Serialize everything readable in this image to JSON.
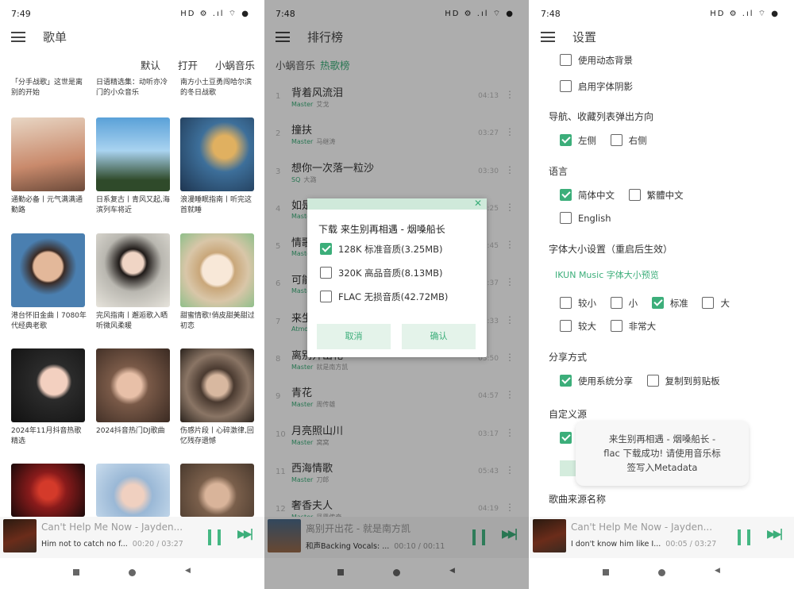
{
  "screens": {
    "playlists": {
      "status_time": "7:49",
      "status_icons": "HD ⚙ .ıl ⌔ ●",
      "title": "歌单",
      "sort_options": [
        "默认",
        "打开",
        "小蜗音乐"
      ],
      "top_captions": [
        "「分手战歌」这世是离别的开始",
        "日语精选集：动听亦冷门的小众音乐",
        "南方小土豆勇闯哈尔滨的冬日战歌"
      ],
      "playlists": [
        {
          "caption": "通勤必备丨元气满满通勤路",
          "color": "#c98a6c"
        },
        {
          "caption": "日系复古丨青风又起,海滨列车将近",
          "color": "#5aa1d8"
        },
        {
          "caption": "浪漫睡眠指南丨听完这首就睡",
          "color": "#3d6f9a"
        },
        {
          "caption": "港台怀旧金曲丨7080年代经典老歌",
          "color": "#4a7fb0"
        },
        {
          "caption": "完风指南丨邂逅歌入晒听微风柔暖",
          "color": "#b9b7b0"
        },
        {
          "caption": "甜蜜情歌!俏皮甜美甜过初恋",
          "color": "#d9c6a8"
        },
        {
          "caption": "2024年11月抖音热歌精选",
          "color": "#2b2b2b"
        },
        {
          "caption": "2024抖音热门DJ歌曲",
          "color": "#7a5a48"
        },
        {
          "caption": "伤感片段丨心碎激律,回忆残存遗憾",
          "color": "#8a7565"
        },
        {
          "caption": "",
          "color": "#8a1b1b"
        },
        {
          "caption": "",
          "color": "#9ab8d6"
        },
        {
          "caption": "",
          "color": "#7a5f4b"
        }
      ],
      "player": {
        "track": "Can't Help Me Now - Jayden...",
        "lyric": "Him not to catch no f...",
        "time": "00:20 / 03:27"
      }
    },
    "ranking": {
      "status_time": "7:48",
      "status_icons": "HD ⚙ .ıl ⌔ ●",
      "title": "排行榜",
      "tabs": [
        "小蜗音乐",
        "热歌榜"
      ],
      "songs": [
        {
          "num": "1",
          "title": "背着风流泪",
          "quality": "Master",
          "artist": "艾戈",
          "duration": "04:13"
        },
        {
          "num": "2",
          "title": "撞扶",
          "quality": "Master",
          "artist": "马继涛",
          "duration": "03:27"
        },
        {
          "num": "3",
          "title": "想你一次落一粒沙",
          "quality": "SQ",
          "artist": "大潞",
          "duration": "03:30"
        },
        {
          "num": "4",
          "title": "如是",
          "quality": "Master",
          "artist": "",
          "duration": "03:25"
        },
        {
          "num": "5",
          "title": "情歌",
          "quality": "Master",
          "artist": "",
          "duration": "03:45"
        },
        {
          "num": "6",
          "title": "可能",
          "quality": "Master",
          "artist": "",
          "duration": "03:37"
        },
        {
          "num": "7",
          "title": "来生",
          "quality": "Atmos",
          "artist": "",
          "duration": "04:33"
        },
        {
          "num": "8",
          "title": "离别开出花",
          "quality": "Master",
          "artist": "就是南方凯",
          "duration": "03:50"
        },
        {
          "num": "9",
          "title": "青花",
          "quality": "Master",
          "artist": "周传雄",
          "duration": "04:57"
        },
        {
          "num": "10",
          "title": "月亮照山川",
          "quality": "Master",
          "artist": "窝窝",
          "duration": "03:17"
        },
        {
          "num": "11",
          "title": "西海情歌",
          "quality": "Master",
          "artist": "刀郎",
          "duration": "05:43"
        },
        {
          "num": "12",
          "title": "奢香夫人",
          "quality": "Master",
          "artist": "凤凰传奇",
          "duration": "04:19"
        }
      ],
      "dialog": {
        "title": "下载 来生别再相遇 - 烟嗓船长",
        "options": [
          {
            "label": "128K 标准音质(3.25MB)",
            "checked": true
          },
          {
            "label": "320K 高品音质(8.13MB)",
            "checked": false
          },
          {
            "label": "FLAC 无损音质(42.72MB)",
            "checked": false
          }
        ],
        "cancel": "取消",
        "confirm": "确认"
      },
      "player": {
        "track": "离别开出花 - 就是南方凯",
        "lyric": "和声Backing Vocals: ...",
        "time": "00:10 / 00:11"
      }
    },
    "settings": {
      "status_time": "7:48",
      "status_icons": "HD ⚙ .ıl ⌔ ●",
      "title": "设置",
      "dynamic_bg": "使用动态背景",
      "font_shadow": "启用字体阴影",
      "nav_direction_title": "导航、收藏列表弹出方向",
      "nav_left": "左侧",
      "nav_right": "右侧",
      "language_title": "语言",
      "lang_simplified": "简体中文",
      "lang_traditional": "繁體中文",
      "lang_english": "English",
      "font_size_title": "字体大小设置（重启后生效）",
      "font_preview": "IKUN Music 字体大小预览",
      "sizes": [
        "较小",
        "小",
        "标准",
        "大",
        "较大",
        "非常大"
      ],
      "share_title": "分享方式",
      "share_system": "使用系统分享",
      "share_clipboard": "复制到剪贴板",
      "custom_source_title": "自定义源",
      "source_name_title": "歌曲来源名称",
      "toast": [
        "来生别再相遇 - 烟嗓船长 -",
        "flac 下载成功! 请使用音乐标",
        "签写入Metadata"
      ],
      "player": {
        "track": "Can't Help Me Now - Jayden...",
        "lyric": "I don't know him like I...",
        "time": "00:05 / 03:27"
      }
    }
  }
}
